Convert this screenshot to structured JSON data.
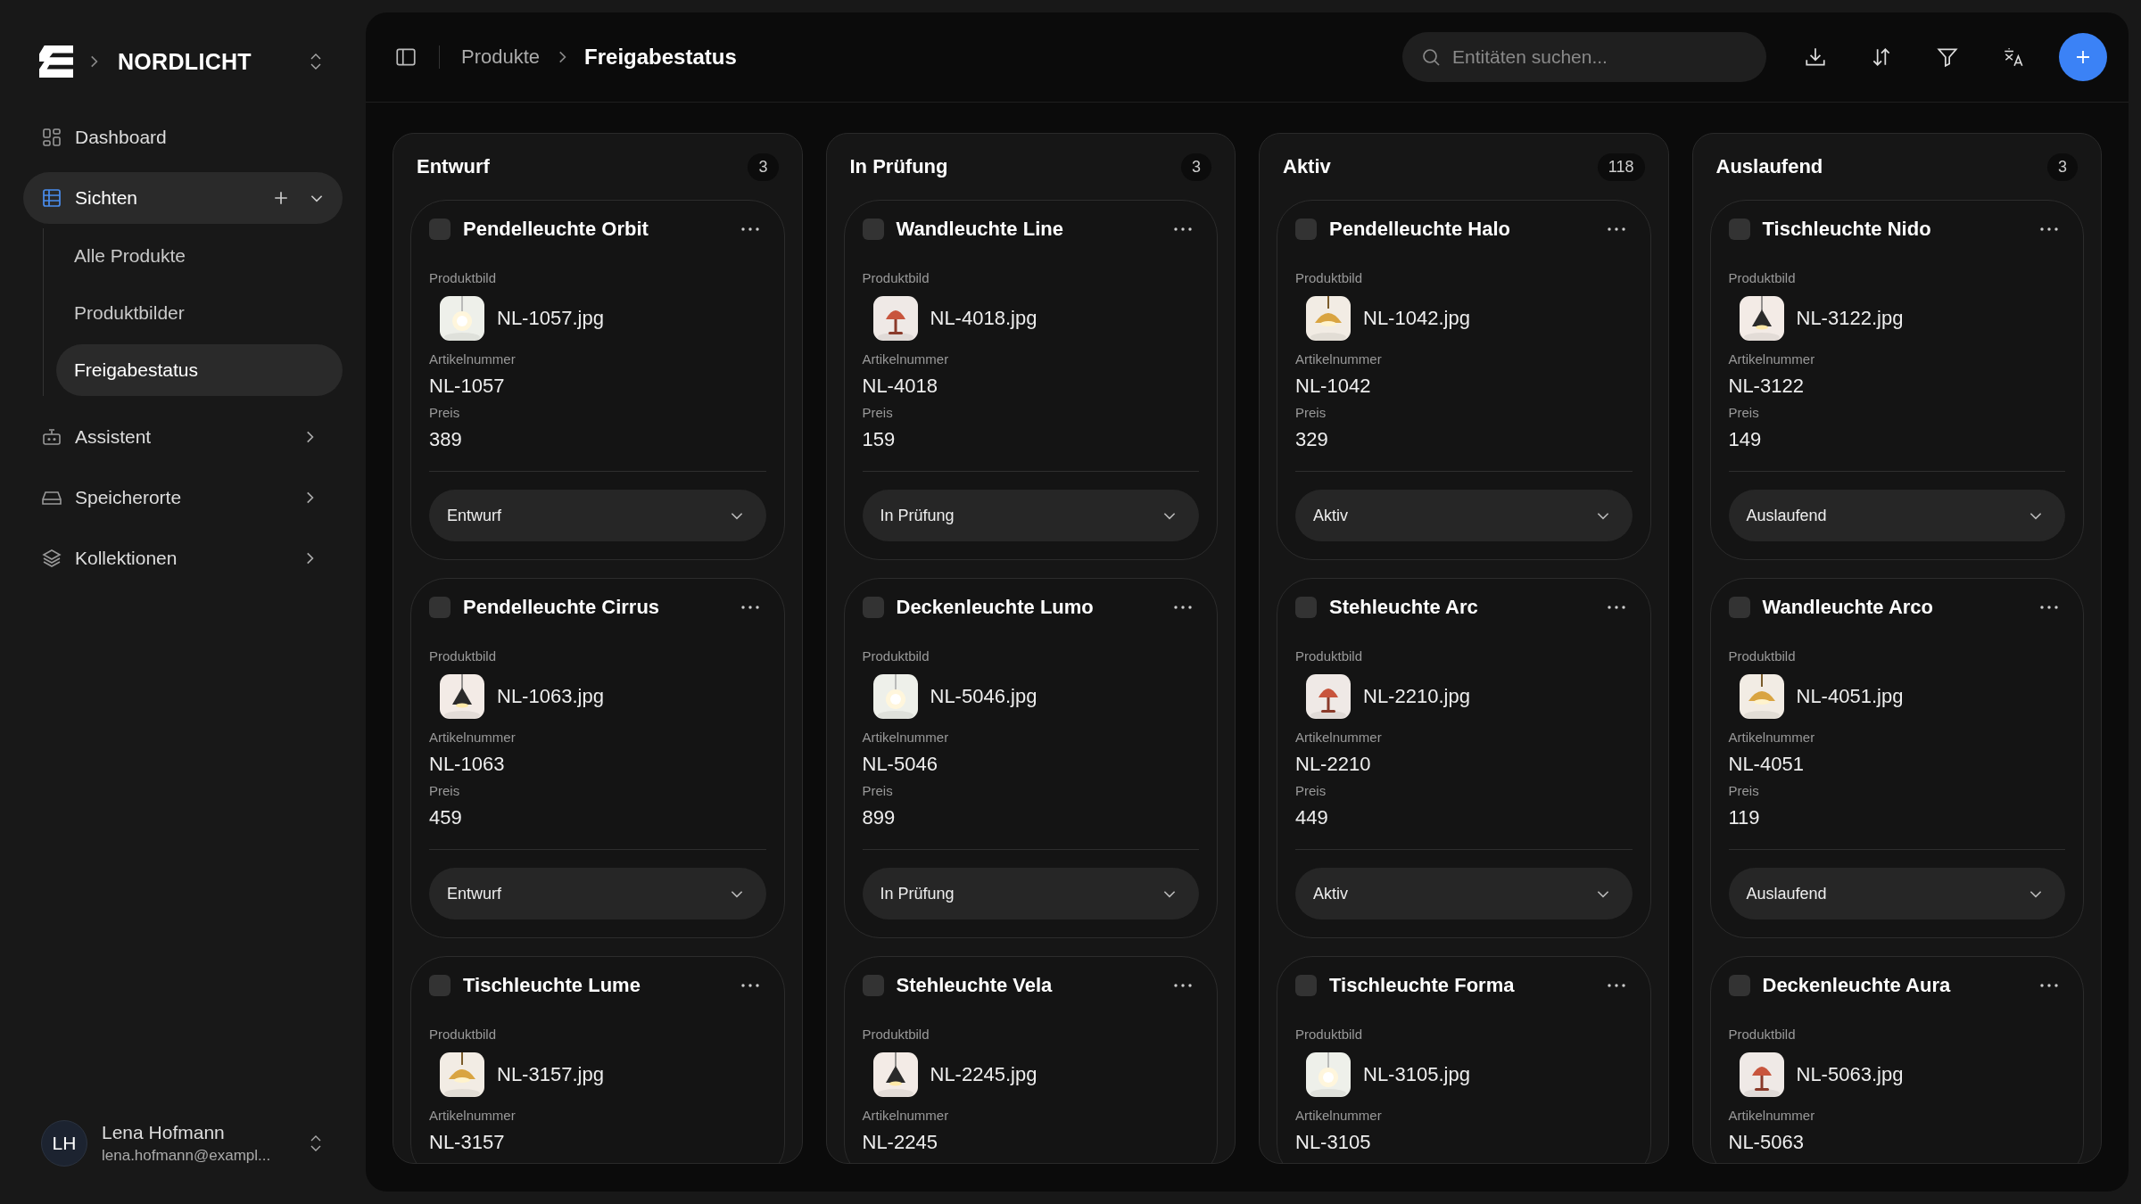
{
  "sidebar": {
    "brand": "NORDLICHT",
    "items": [
      {
        "label": "Dashboard",
        "kind": "link",
        "selected": false
      },
      {
        "label": "Sichten",
        "kind": "group",
        "selected": true,
        "expanded": true,
        "children": [
          {
            "label": "Alle Produkte",
            "selected": false
          },
          {
            "label": "Produktbilder",
            "selected": false
          },
          {
            "label": "Freigabestatus",
            "selected": true
          }
        ]
      },
      {
        "label": "Assistent",
        "kind": "group",
        "selected": false,
        "expanded": false
      },
      {
        "label": "Speicherorte",
        "kind": "group",
        "selected": false,
        "expanded": false
      },
      {
        "label": "Kollektionen",
        "kind": "group",
        "selected": false,
        "expanded": false
      }
    ],
    "user": {
      "initials": "LH",
      "name": "Lena Hofmann",
      "email": "lena.hofmann@exampl..."
    }
  },
  "header": {
    "breadcrumb": [
      "Produkte",
      "Freigabestatus"
    ],
    "search": {
      "placeholder": "Entitäten suchen..."
    }
  },
  "columns": [
    {
      "title": "Entwurf",
      "count": "3",
      "cards": [
        {
          "title": "Pendelleuchte Orbit",
          "checked": false,
          "image_label": "Produktbild",
          "file": "NL-1057.jpg",
          "sku_label": "Artikelnummer",
          "sku": "NL-1057",
          "price_label": "Preis",
          "price": "389",
          "status": "Entwurf"
        },
        {
          "title": "Pendelleuchte Cirrus",
          "checked": false,
          "image_label": "Produktbild",
          "file": "NL-1063.jpg",
          "sku_label": "Artikelnummer",
          "sku": "NL-1063",
          "price_label": "Preis",
          "price": "459",
          "status": "Entwurf"
        },
        {
          "title": "Tischleuchte Lume",
          "checked": false,
          "image_label": "Produktbild",
          "file": "NL-3157.jpg",
          "sku_label": "Artikelnummer",
          "sku": "NL-3157"
        }
      ]
    },
    {
      "title": "In Prüfung",
      "count": "3",
      "cards": [
        {
          "title": "Wandleuchte Line",
          "checked": false,
          "image_label": "Produktbild",
          "file": "NL-4018.jpg",
          "sku_label": "Artikelnummer",
          "sku": "NL-4018",
          "price_label": "Preis",
          "price": "159",
          "status": "In Prüfung"
        },
        {
          "title": "Deckenleuchte Lumo",
          "checked": false,
          "image_label": "Produktbild",
          "file": "NL-5046.jpg",
          "sku_label": "Artikelnummer",
          "sku": "NL-5046",
          "price_label": "Preis",
          "price": "899",
          "status": "In Prüfung"
        },
        {
          "title": "Stehleuchte Vela",
          "checked": false,
          "image_label": "Produktbild",
          "file": "NL-2245.jpg",
          "sku_label": "Artikelnummer",
          "sku": "NL-2245"
        }
      ]
    },
    {
      "title": "Aktiv",
      "count": "118",
      "cards": [
        {
          "title": "Pendelleuchte Halo",
          "checked": false,
          "image_label": "Produktbild",
          "file": "NL-1042.jpg",
          "sku_label": "Artikelnummer",
          "sku": "NL-1042",
          "price_label": "Preis",
          "price": "329",
          "status": "Aktiv"
        },
        {
          "title": "Stehleuchte Arc",
          "checked": false,
          "image_label": "Produktbild",
          "file": "NL-2210.jpg",
          "sku_label": "Artikelnummer",
          "sku": "NL-2210",
          "price_label": "Preis",
          "price": "449",
          "status": "Aktiv"
        },
        {
          "title": "Tischleuchte Forma",
          "checked": false,
          "image_label": "Produktbild",
          "file": "NL-3105.jpg",
          "sku_label": "Artikelnummer",
          "sku": "NL-3105"
        }
      ]
    },
    {
      "title": "Auslaufend",
      "count": "3",
      "cards": [
        {
          "title": "Tischleuchte Nido",
          "checked": false,
          "image_label": "Produktbild",
          "file": "NL-3122.jpg",
          "sku_label": "Artikelnummer",
          "sku": "NL-3122",
          "price_label": "Preis",
          "price": "149",
          "status": "Auslaufend"
        },
        {
          "title": "Wandleuchte Arco",
          "checked": false,
          "image_label": "Produktbild",
          "file": "NL-4051.jpg",
          "sku_label": "Artikelnummer",
          "sku": "NL-4051",
          "price_label": "Preis",
          "price": "119",
          "status": "Auslaufend"
        },
        {
          "title": "Deckenleuchte Aura",
          "checked": false,
          "image_label": "Produktbild",
          "file": "NL-5063.jpg",
          "sku_label": "Artikelnummer",
          "sku": "NL-5063"
        }
      ]
    }
  ]
}
